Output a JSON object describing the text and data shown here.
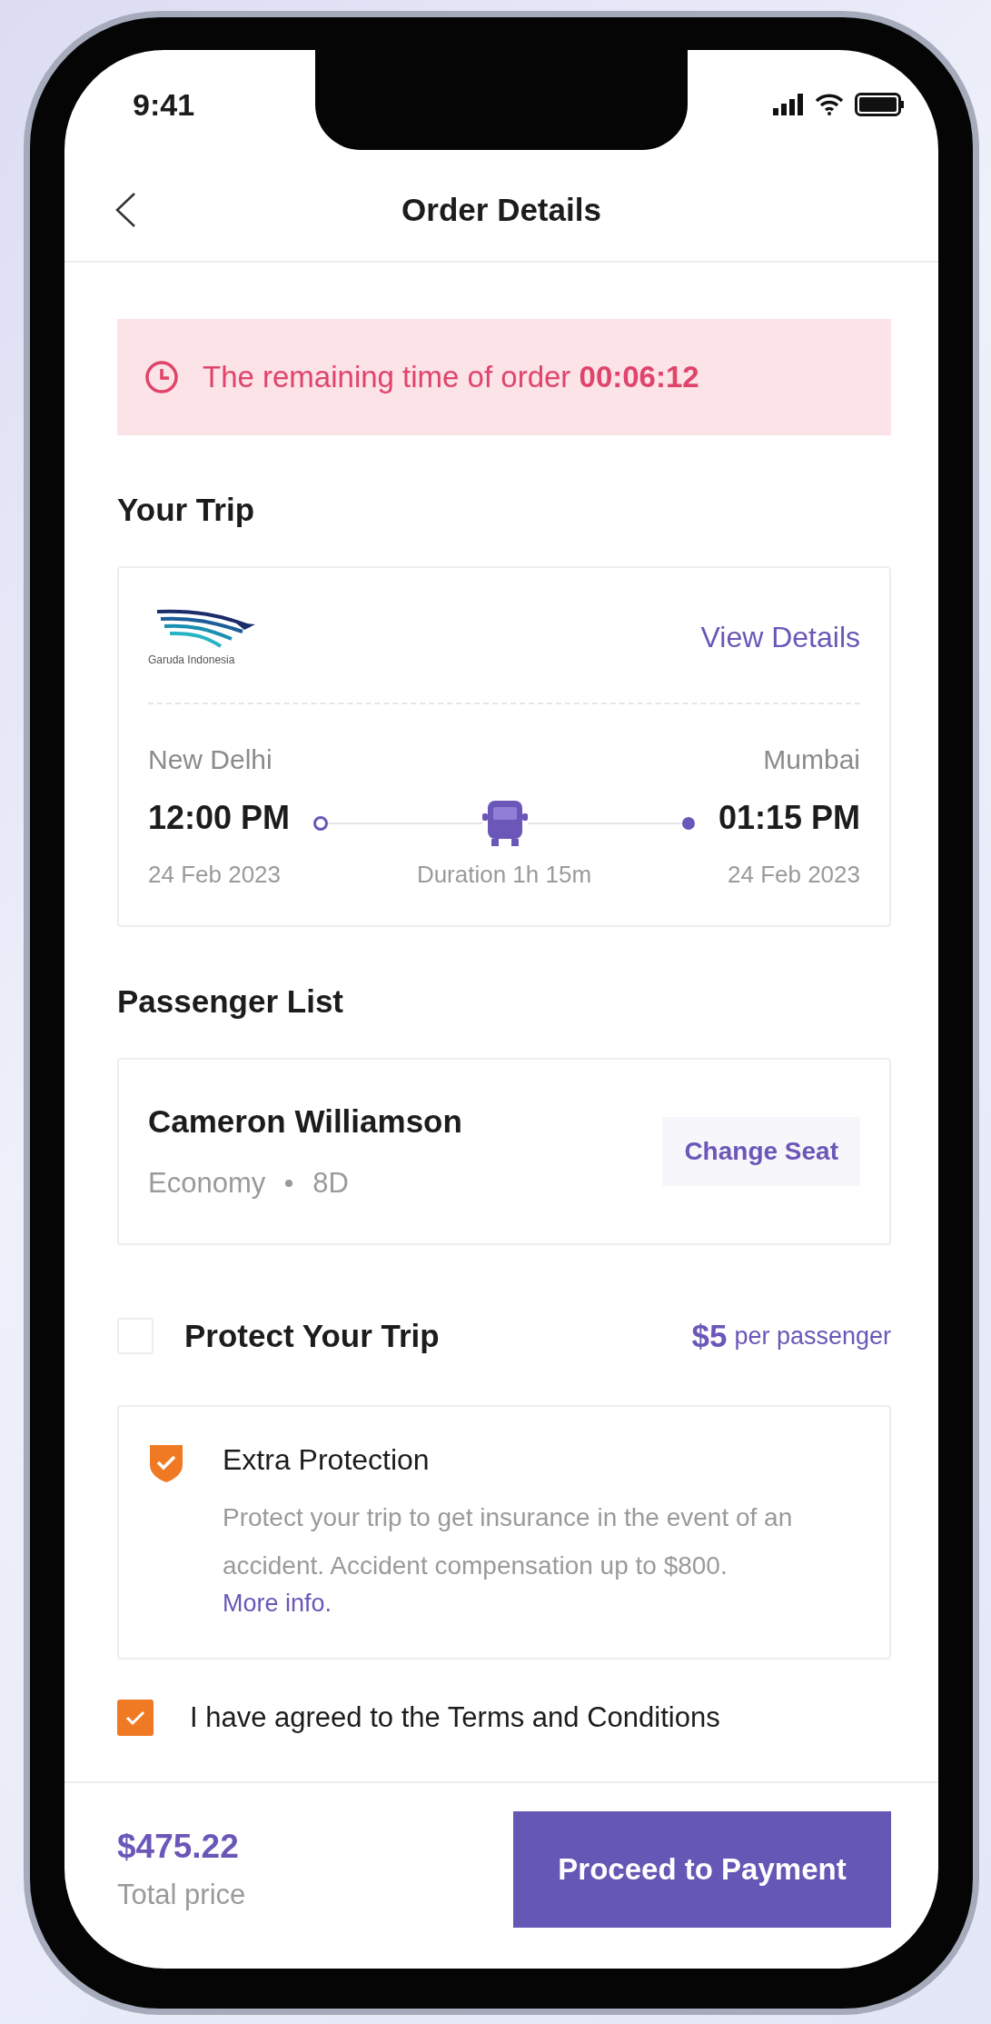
{
  "status_bar": {
    "time": "9:41"
  },
  "header": {
    "title": "Order Details"
  },
  "timer": {
    "text": "The remaining time of order",
    "time": "00:06:12"
  },
  "trip": {
    "title": "Your Trip",
    "airline_name": "Garuda Indonesia",
    "details_link": "View Details",
    "from": {
      "city": "New Delhi",
      "time": "12:00 PM",
      "date": "24 Feb 2023"
    },
    "to": {
      "city": "Mumbai",
      "time": "01:15 PM",
      "date": "24 Feb 2023"
    },
    "duration": "Duration 1h 15m"
  },
  "passengers": {
    "title": "Passenger List",
    "items": [
      {
        "name": "Cameron Williamson",
        "class": "Economy",
        "seat": "8D",
        "action": "Change Seat"
      }
    ]
  },
  "protection": {
    "title": "Protect Your Trip",
    "checked": false,
    "price": "$5",
    "price_unit": "per passenger",
    "option": {
      "title": "Extra Protection",
      "description": "Protect your trip to get insurance in the event of an accident. Accident compensation up to $800.",
      "link": "More info."
    }
  },
  "terms": {
    "text": "I have agreed to the Terms and Conditions",
    "checked": true
  },
  "footer": {
    "total": "$475.22",
    "total_label": "Total price",
    "button": "Proceed to Payment"
  }
}
